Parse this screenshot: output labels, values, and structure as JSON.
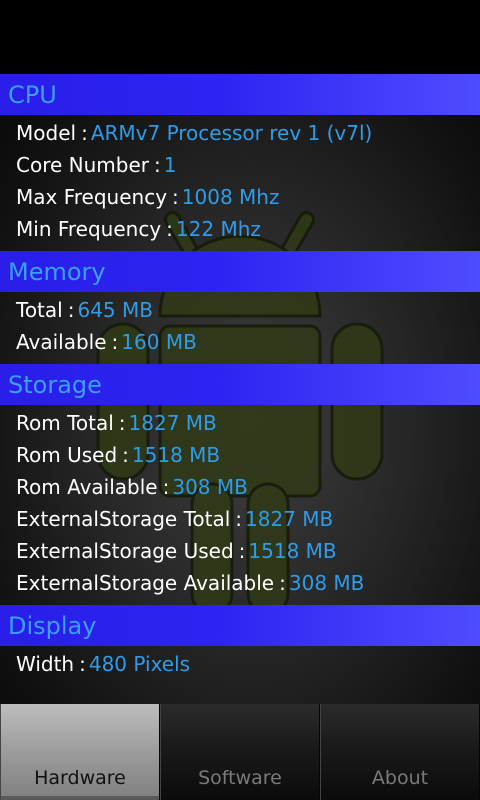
{
  "sections": [
    {
      "title": "CPU",
      "rows": [
        {
          "label": "Model",
          "value": "ARMv7 Processor rev 1 (v7l)"
        },
        {
          "label": "Core Number",
          "value": "1"
        },
        {
          "label": "Max Frequency",
          "value": "1008 Mhz"
        },
        {
          "label": "Min Frequency",
          "value": "122 Mhz"
        }
      ]
    },
    {
      "title": "Memory",
      "rows": [
        {
          "label": "Total",
          "value": "645 MB"
        },
        {
          "label": "Available",
          "value": "160 MB"
        }
      ]
    },
    {
      "title": "Storage",
      "rows": [
        {
          "label": "Rom Total",
          "value": "1827 MB"
        },
        {
          "label": "Rom Used",
          "value": "1518 MB"
        },
        {
          "label": "Rom Available",
          "value": "308 MB"
        },
        {
          "label": "ExternalStorage Total",
          "value": "1827 MB"
        },
        {
          "label": "ExternalStorage Used",
          "value": "1518 MB"
        },
        {
          "label": "ExternalStorage Available",
          "value": "308 MB"
        }
      ]
    },
    {
      "title": "Display",
      "rows": [
        {
          "label": "Width",
          "value": "480 Pixels"
        }
      ]
    }
  ],
  "separator": ":",
  "tabs": [
    {
      "label": "Hardware",
      "active": true
    },
    {
      "label": "Software",
      "active": false
    },
    {
      "label": "About",
      "active": false
    }
  ],
  "colors": {
    "header_gradient_start": "#2a1ee8",
    "header_gradient_end": "#4f4cff",
    "header_text": "#3aa0ff",
    "value_text": "#2f9ce8",
    "label_text": "#ffffff"
  },
  "background_icon": "android-robot-icon"
}
